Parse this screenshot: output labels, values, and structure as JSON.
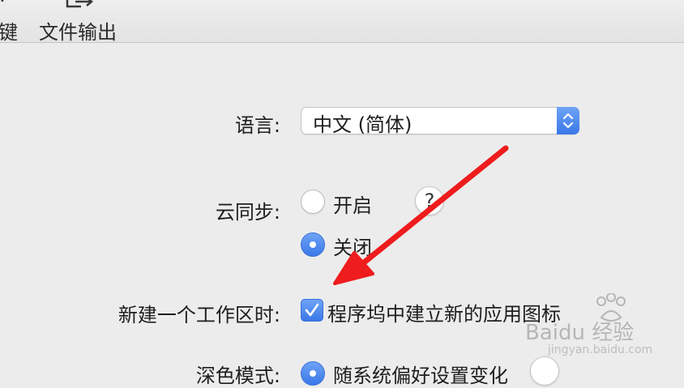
{
  "toolbar": {
    "items": [
      {
        "label": "键",
        "icon": "keyboard-icon"
      },
      {
        "label": "文件输出",
        "icon": "export-icon"
      }
    ]
  },
  "settings": {
    "language": {
      "label": "语言:",
      "value": "中文 (简体)"
    },
    "cloud_sync": {
      "label": "云同步:",
      "options": [
        {
          "label": "开启",
          "selected": false
        },
        {
          "label": "关闭",
          "selected": true
        }
      ],
      "help": "?"
    },
    "new_workspace": {
      "label": "新建一个工作区时:",
      "checkbox_label": "程序坞中建立新的应用图标",
      "checked": true
    },
    "dark_mode": {
      "label": "深色模式:",
      "option_label": "随系统偏好设置变化",
      "selected": true
    }
  },
  "watermark": {
    "brand": "Baidu 经验",
    "url": "jingyan.baidu.com"
  },
  "colors": {
    "accent": "#3a78e8",
    "annotation_arrow": "#ee1c1c",
    "background": "#ececec"
  }
}
